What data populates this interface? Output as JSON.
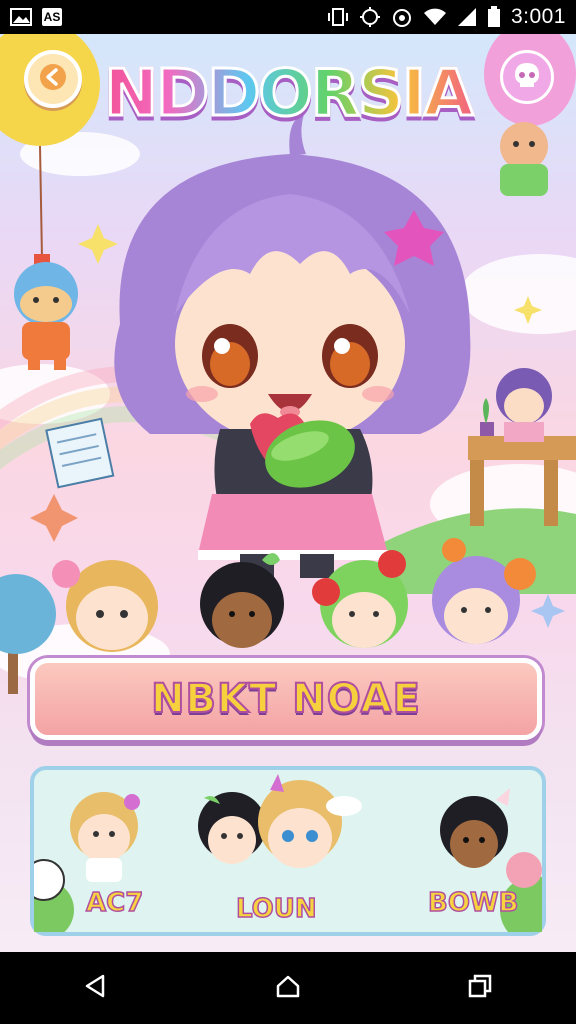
{
  "status_bar": {
    "app_badge": "AS",
    "time": "3:001"
  },
  "game": {
    "title": "NDDORSIA",
    "main_button_label": "NBKT NOAE",
    "characters": [
      {
        "label": "AC7"
      },
      {
        "label": "LOUN"
      },
      {
        "label": "BOWB"
      }
    ]
  },
  "colors": {
    "accent_pink": "#f04f8e",
    "accent_yellow": "#f7c33c",
    "button_border": "#c38bcf",
    "roster_bg": "#dff4f0"
  },
  "icons": {
    "back": "chevron-left-icon",
    "menu": "skull-icon",
    "nav_back": "triangle-back-icon",
    "nav_home": "home-icon",
    "nav_recents": "recents-icon"
  }
}
